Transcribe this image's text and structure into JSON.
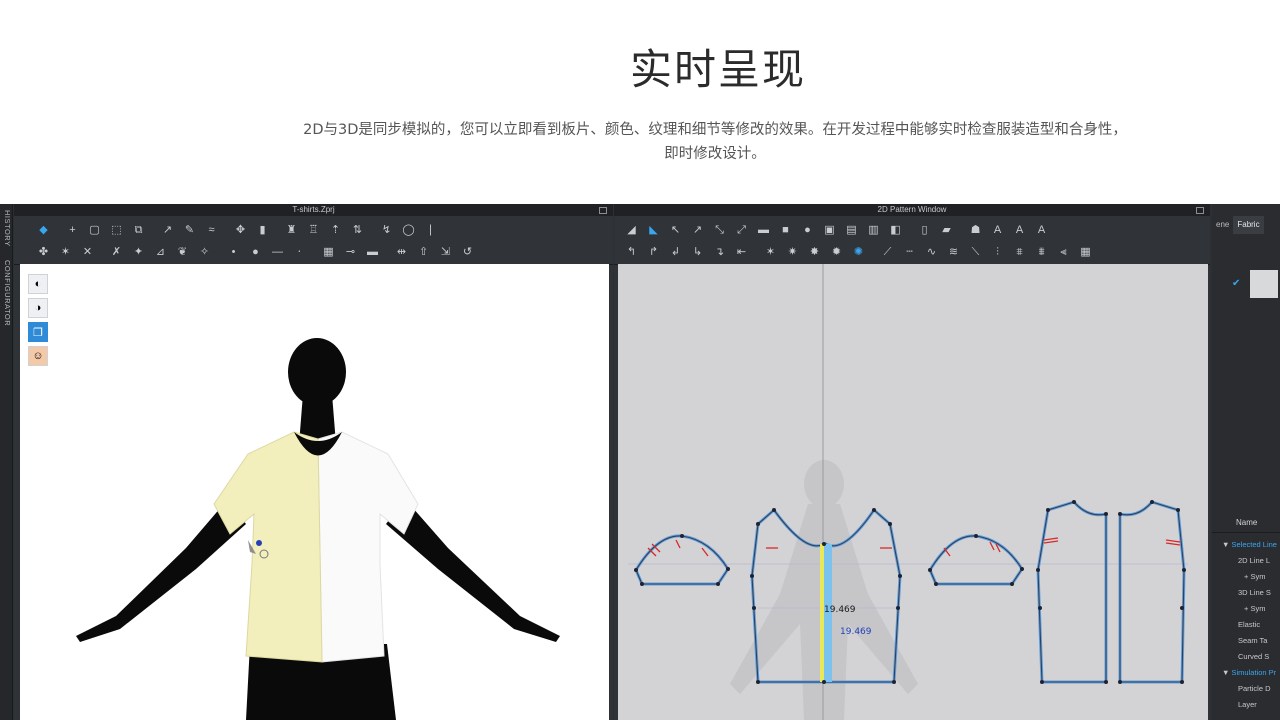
{
  "hero": {
    "title": "实时呈现",
    "description_line1": "2D与3D是同步模拟的，您可以立即看到板片、颜色、纹理和细节等修改的效果。在开发过程中能够实时检查服装造型和合身性，",
    "description_line2": "即时修改设计。"
  },
  "side_tabs": [
    "HISTORY",
    "CONFIGURATOR"
  ],
  "window3d": {
    "title": "T-shirts.Zprj"
  },
  "window2d": {
    "title": "2D Pattern Window"
  },
  "measurements": {
    "front_width": "19.469",
    "placket_width": "19.469"
  },
  "property_panel": {
    "tabs": [
      "ene",
      "Fabric"
    ],
    "tree_header": "Name",
    "tree_items": [
      {
        "label": "Selected Line",
        "group": true
      },
      {
        "label": "2D Line L",
        "group": false
      },
      {
        "label": "+ Sym",
        "group": false
      },
      {
        "label": "3D Line S",
        "group": false
      },
      {
        "label": "+ Sym",
        "group": false
      },
      {
        "label": "Elastic",
        "group": false
      },
      {
        "label": "Seam Ta",
        "group": false
      },
      {
        "label": "Curved S",
        "group": false
      },
      {
        "label": "Simulation Pr",
        "group": true
      },
      {
        "label": "Particle D",
        "group": false
      },
      {
        "label": "Layer",
        "group": false
      }
    ]
  },
  "colors": {
    "accent": "#39a6f0",
    "fabric_yellow": "#f2efbd",
    "fabric_white": "#fafafa",
    "avatar": "#0a0a0a",
    "pattern_outline": "#5aa0e6"
  }
}
